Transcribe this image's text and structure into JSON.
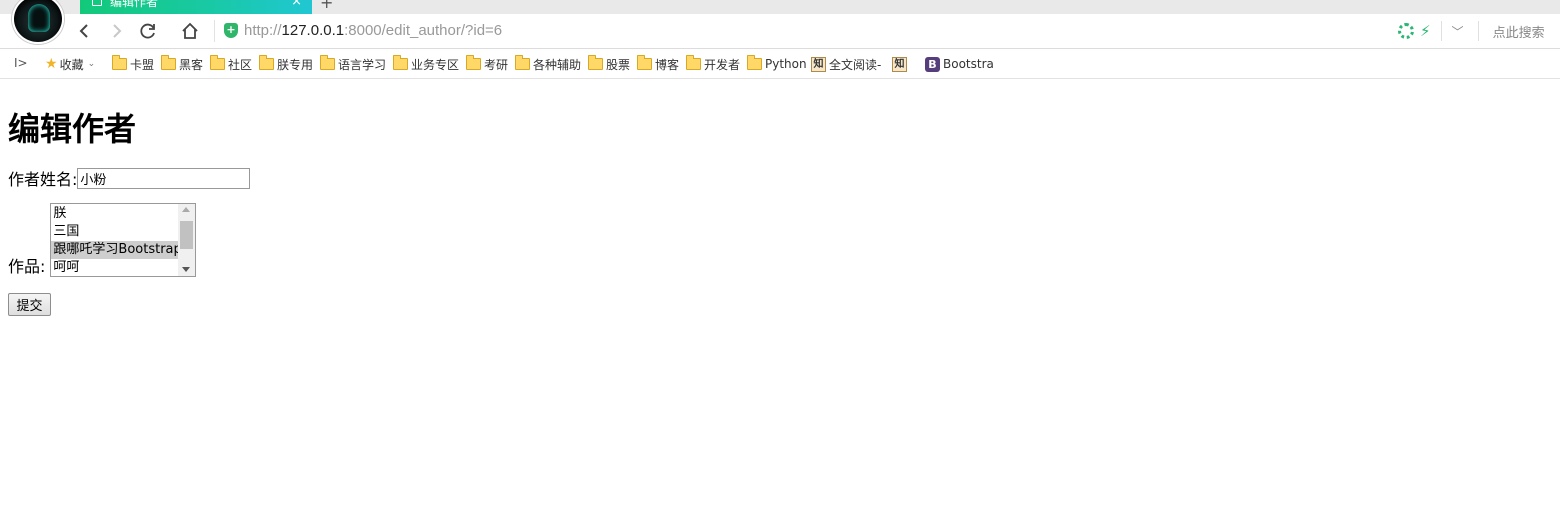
{
  "browser": {
    "tab_title": "编辑作者",
    "new_tab_symbol": "+",
    "close_symbol": "×",
    "url_scheme": "http://",
    "url_host": "127.0.0.1",
    "url_rest": ":8000/edit_author/?id=6",
    "search_hint": "点此搜索",
    "secure_icon": "shield-plus-icon",
    "accent_color": "#12c97a"
  },
  "bookmarks": {
    "toggle_symbol": "I>",
    "items": [
      {
        "label": "收藏",
        "icon": "star-icon"
      },
      {
        "label": "卡盟",
        "icon": "folder-icon"
      },
      {
        "label": "黑客",
        "icon": "folder-icon"
      },
      {
        "label": "社区",
        "icon": "folder-icon"
      },
      {
        "label": "朕专用",
        "icon": "folder-icon"
      },
      {
        "label": "语言学习",
        "icon": "folder-icon"
      },
      {
        "label": "业务专区",
        "icon": "folder-icon"
      },
      {
        "label": "考研",
        "icon": "folder-icon"
      },
      {
        "label": "各种辅助",
        "icon": "folder-icon"
      },
      {
        "label": "股票",
        "icon": "folder-icon"
      },
      {
        "label": "博客",
        "icon": "folder-icon"
      },
      {
        "label": "开发者",
        "icon": "folder-icon"
      },
      {
        "label": "Python",
        "icon": "folder-icon"
      },
      {
        "label": "全文阅读-",
        "icon": "zhi-icon"
      },
      {
        "label": "",
        "icon": "zhi-icon"
      },
      {
        "label": "Bootstra",
        "icon": "bootstrap-icon"
      }
    ]
  },
  "page": {
    "title": "编辑作者",
    "name_label": "作者姓名:",
    "name_value": "小粉",
    "works_label": "作品:",
    "works_options": [
      "朕",
      "三国",
      "跟哪吒学习Bootstrap",
      "呵呵"
    ],
    "works_selected": "跟哪吒学习Bootstrap",
    "submit_label": "提交"
  }
}
